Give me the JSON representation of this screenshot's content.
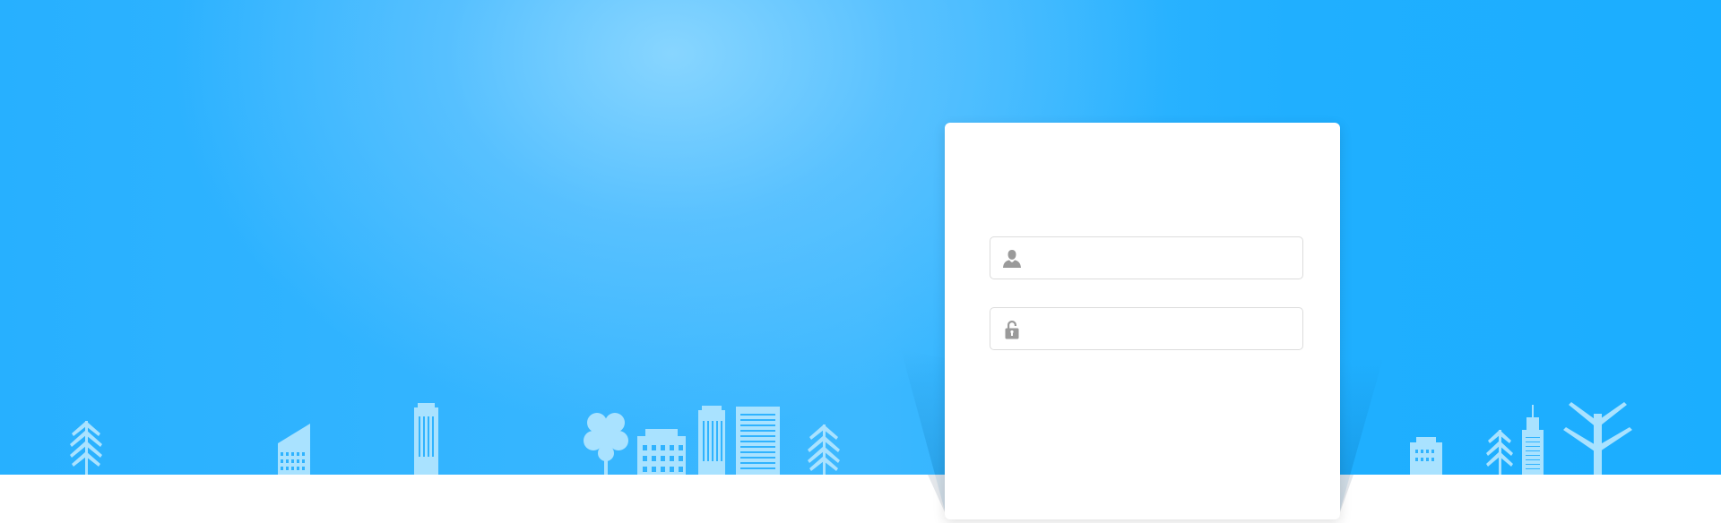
{
  "login": {
    "username": {
      "value": "",
      "placeholder": "",
      "icon": "user-icon"
    },
    "password": {
      "value": "",
      "placeholder": "",
      "icon": "lock-icon"
    }
  },
  "colors": {
    "sky": "#1baeff",
    "sky_glow": "#8cd7ff",
    "skyline": "#a9e2ff",
    "card": "#ffffff",
    "field_border": "#dcdcdc",
    "icon": "#9a9a9a"
  }
}
